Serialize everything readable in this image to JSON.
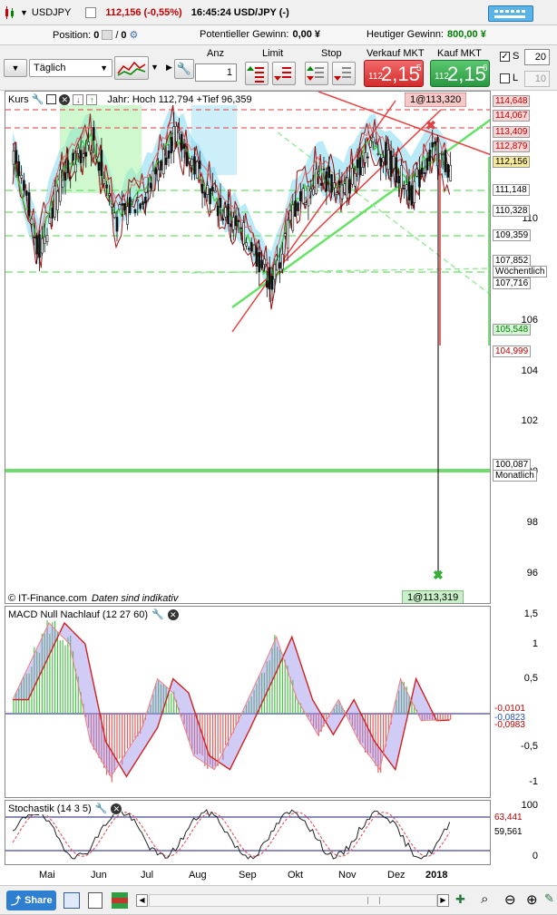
{
  "header": {
    "symbol": "USDJPY",
    "price": "112,156 (-0,55%)",
    "time": "16:45:24 USD/JPY (-)"
  },
  "infobar": {
    "position_label": "Position:",
    "position_value": "0",
    "position_value2": "0",
    "potential_label": "Potentieller Gewinn:",
    "potential_value": "0,00 ¥",
    "today_label": "Heutiger Gewinn:",
    "today_value": "800,00 ¥"
  },
  "toolbar": {
    "period": "Täglich",
    "anz_label": "Anz",
    "anz_value": "1",
    "limit_label": "Limit",
    "stop_label": "Stop",
    "sell_label": "Verkauf MKT",
    "sell_small": "112",
    "sell_big": "2,15",
    "sell_sup": "5",
    "buy_label": "Kauf MKT",
    "buy_small": "112",
    "buy_big": "2,15",
    "buy_sup": "6",
    "s_label": "S",
    "s_value": "20",
    "l_label": "L",
    "l_value": "10"
  },
  "main_panel": {
    "title": "Kurs",
    "year_info": "Jahr: Hoch 112,794 +Tief 96,359",
    "top_badge": "1@113,320",
    "bottom_badge": "1@113,319",
    "copyright": "© IT-Finance.com",
    "disclaimer": "Daten sind indikativ",
    "y_ticks": [
      "110",
      "108",
      "106",
      "104",
      "102",
      "100",
      "98",
      "96"
    ],
    "tags": [
      {
        "text": "114,648",
        "color": "#c00000"
      },
      {
        "text": "114,067",
        "color": "#c00000"
      },
      {
        "text": "113,409",
        "color": "#c00000"
      },
      {
        "text": "112,879",
        "color": "#c00000"
      },
      {
        "text": "112,156",
        "color": "#000000"
      },
      {
        "text": "111,148",
        "color": "#000000"
      },
      {
        "text": "110,328",
        "color": "#000000"
      },
      {
        "text": "109,359",
        "color": "#000000"
      },
      {
        "text": "107,852",
        "color": "#000000"
      },
      {
        "text": "Wöchentlich",
        "color": "#000000"
      },
      {
        "text": "107,716",
        "color": "#000000"
      },
      {
        "text": "105,548",
        "color": "#008000"
      },
      {
        "text": "104,999",
        "color": "#c00000"
      },
      {
        "text": "100,087",
        "color": "#000000"
      },
      {
        "text": "Monatlich",
        "color": "#000000"
      }
    ]
  },
  "macd_panel": {
    "title": "MACD Null Nachlauf (12 27 60)",
    "y_ticks": [
      "1,5",
      "1",
      "0,5",
      "-0,5",
      "-1"
    ],
    "tags": [
      "-0,0101",
      "-0,0823",
      "-0,0983"
    ]
  },
  "stoch_panel": {
    "title": "Stochastik (14 3 5)",
    "y_ticks": [
      "100",
      "0"
    ],
    "tags": [
      "63,441",
      "59,561"
    ]
  },
  "x_axis": [
    "Mai",
    "Jun",
    "Jul",
    "Aug",
    "Sep",
    "Okt",
    "Nov",
    "Dez",
    "2018"
  ],
  "bottom": {
    "share_label": "Share"
  },
  "colors": {
    "sell": "#e03a3a",
    "buy": "#2ea24a",
    "today_gain": "#008000",
    "cloud": "#7fd8f0",
    "cloud_green": "#9ff29f",
    "candles": "#111111"
  }
}
